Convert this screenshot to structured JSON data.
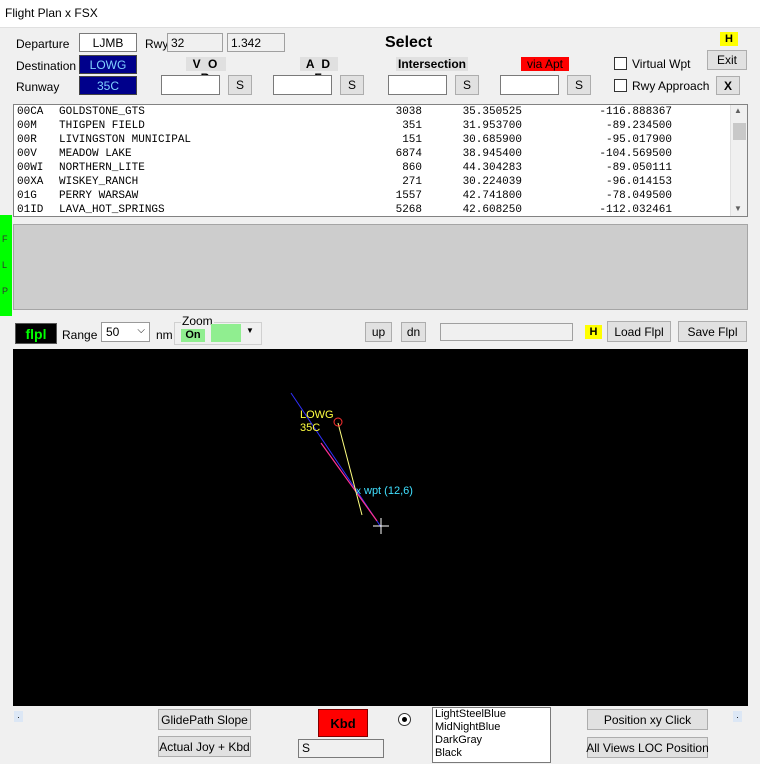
{
  "window": {
    "title": "Flight Plan x FSX"
  },
  "labels": {
    "departure": "Departure",
    "destination": "Destination",
    "runway": "Runway",
    "rwy": "Rwy",
    "select": "Select",
    "vor": "V O R",
    "adf": "A D F",
    "intersection": "Intersection",
    "via_apt": "via Apt",
    "virtual_wpt": "Virtual Wpt",
    "rwy_approach": "Rwy Approach",
    "range": "Range",
    "nm": "nm",
    "zoom": "Zoom"
  },
  "fields": {
    "departure": "LJMB",
    "destination": "LOWG",
    "runway": "35C",
    "rwy_num": "32",
    "rwy_value": "1.342",
    "range": "50",
    "kbd_input": "S"
  },
  "buttons": {
    "s": "S",
    "exit": "Exit",
    "x": "X",
    "h": "H",
    "flpl": "flpl",
    "zoom_on": "On",
    "up": "up",
    "dn": "dn",
    "load": "Load Flpl",
    "save": "Save Flpl",
    "glidepath": "GlidePath Slope",
    "actual_joy": "Actual Joy + Kbd",
    "kbd": "Kbd",
    "position_xy": "Position xy Click",
    "all_views": "All Views LOC Position"
  },
  "side_tab": [
    "F",
    "L",
    "P"
  ],
  "airports": [
    {
      "code": "00CA",
      "name": "GOLDSTONE_GTS",
      "elev": "3038",
      "lat": "35.350525",
      "lon": "-116.888367"
    },
    {
      "code": "00M",
      "name": "THIGPEN FIELD",
      "elev": "351",
      "lat": "31.953700",
      "lon": "-89.234500"
    },
    {
      "code": "00R",
      "name": "LIVINGSTON MUNICIPAL",
      "elev": "151",
      "lat": "30.685900",
      "lon": "-95.017900"
    },
    {
      "code": "00V",
      "name": "MEADOW LAKE",
      "elev": "6874",
      "lat": "38.945400",
      "lon": "-104.569500"
    },
    {
      "code": "00WI",
      "name": "NORTHERN_LITE",
      "elev": "860",
      "lat": "44.304283",
      "lon": "-89.050111"
    },
    {
      "code": "00XA",
      "name": "WISKEY_RANCH",
      "elev": "271",
      "lat": "30.224039",
      "lon": "-96.014153"
    },
    {
      "code": "01G",
      "name": "PERRY WARSAW",
      "elev": "1557",
      "lat": "42.741800",
      "lon": "-78.049500"
    },
    {
      "code": "01ID",
      "name": "LAVA_HOT_SPRINGS",
      "elev": "5268",
      "lat": "42.608250",
      "lon": "-112.032461"
    }
  ],
  "map": {
    "airport": "LOWG",
    "runway": "35C",
    "waypoint": "wpt (12,6)"
  },
  "colors": [
    {
      "label": "LightSteelBlue"
    },
    {
      "label": "MidNightBlue"
    },
    {
      "label": "DarkGray"
    },
    {
      "label": "Black"
    }
  ],
  "dots": {
    "left": ".",
    "right": "."
  }
}
